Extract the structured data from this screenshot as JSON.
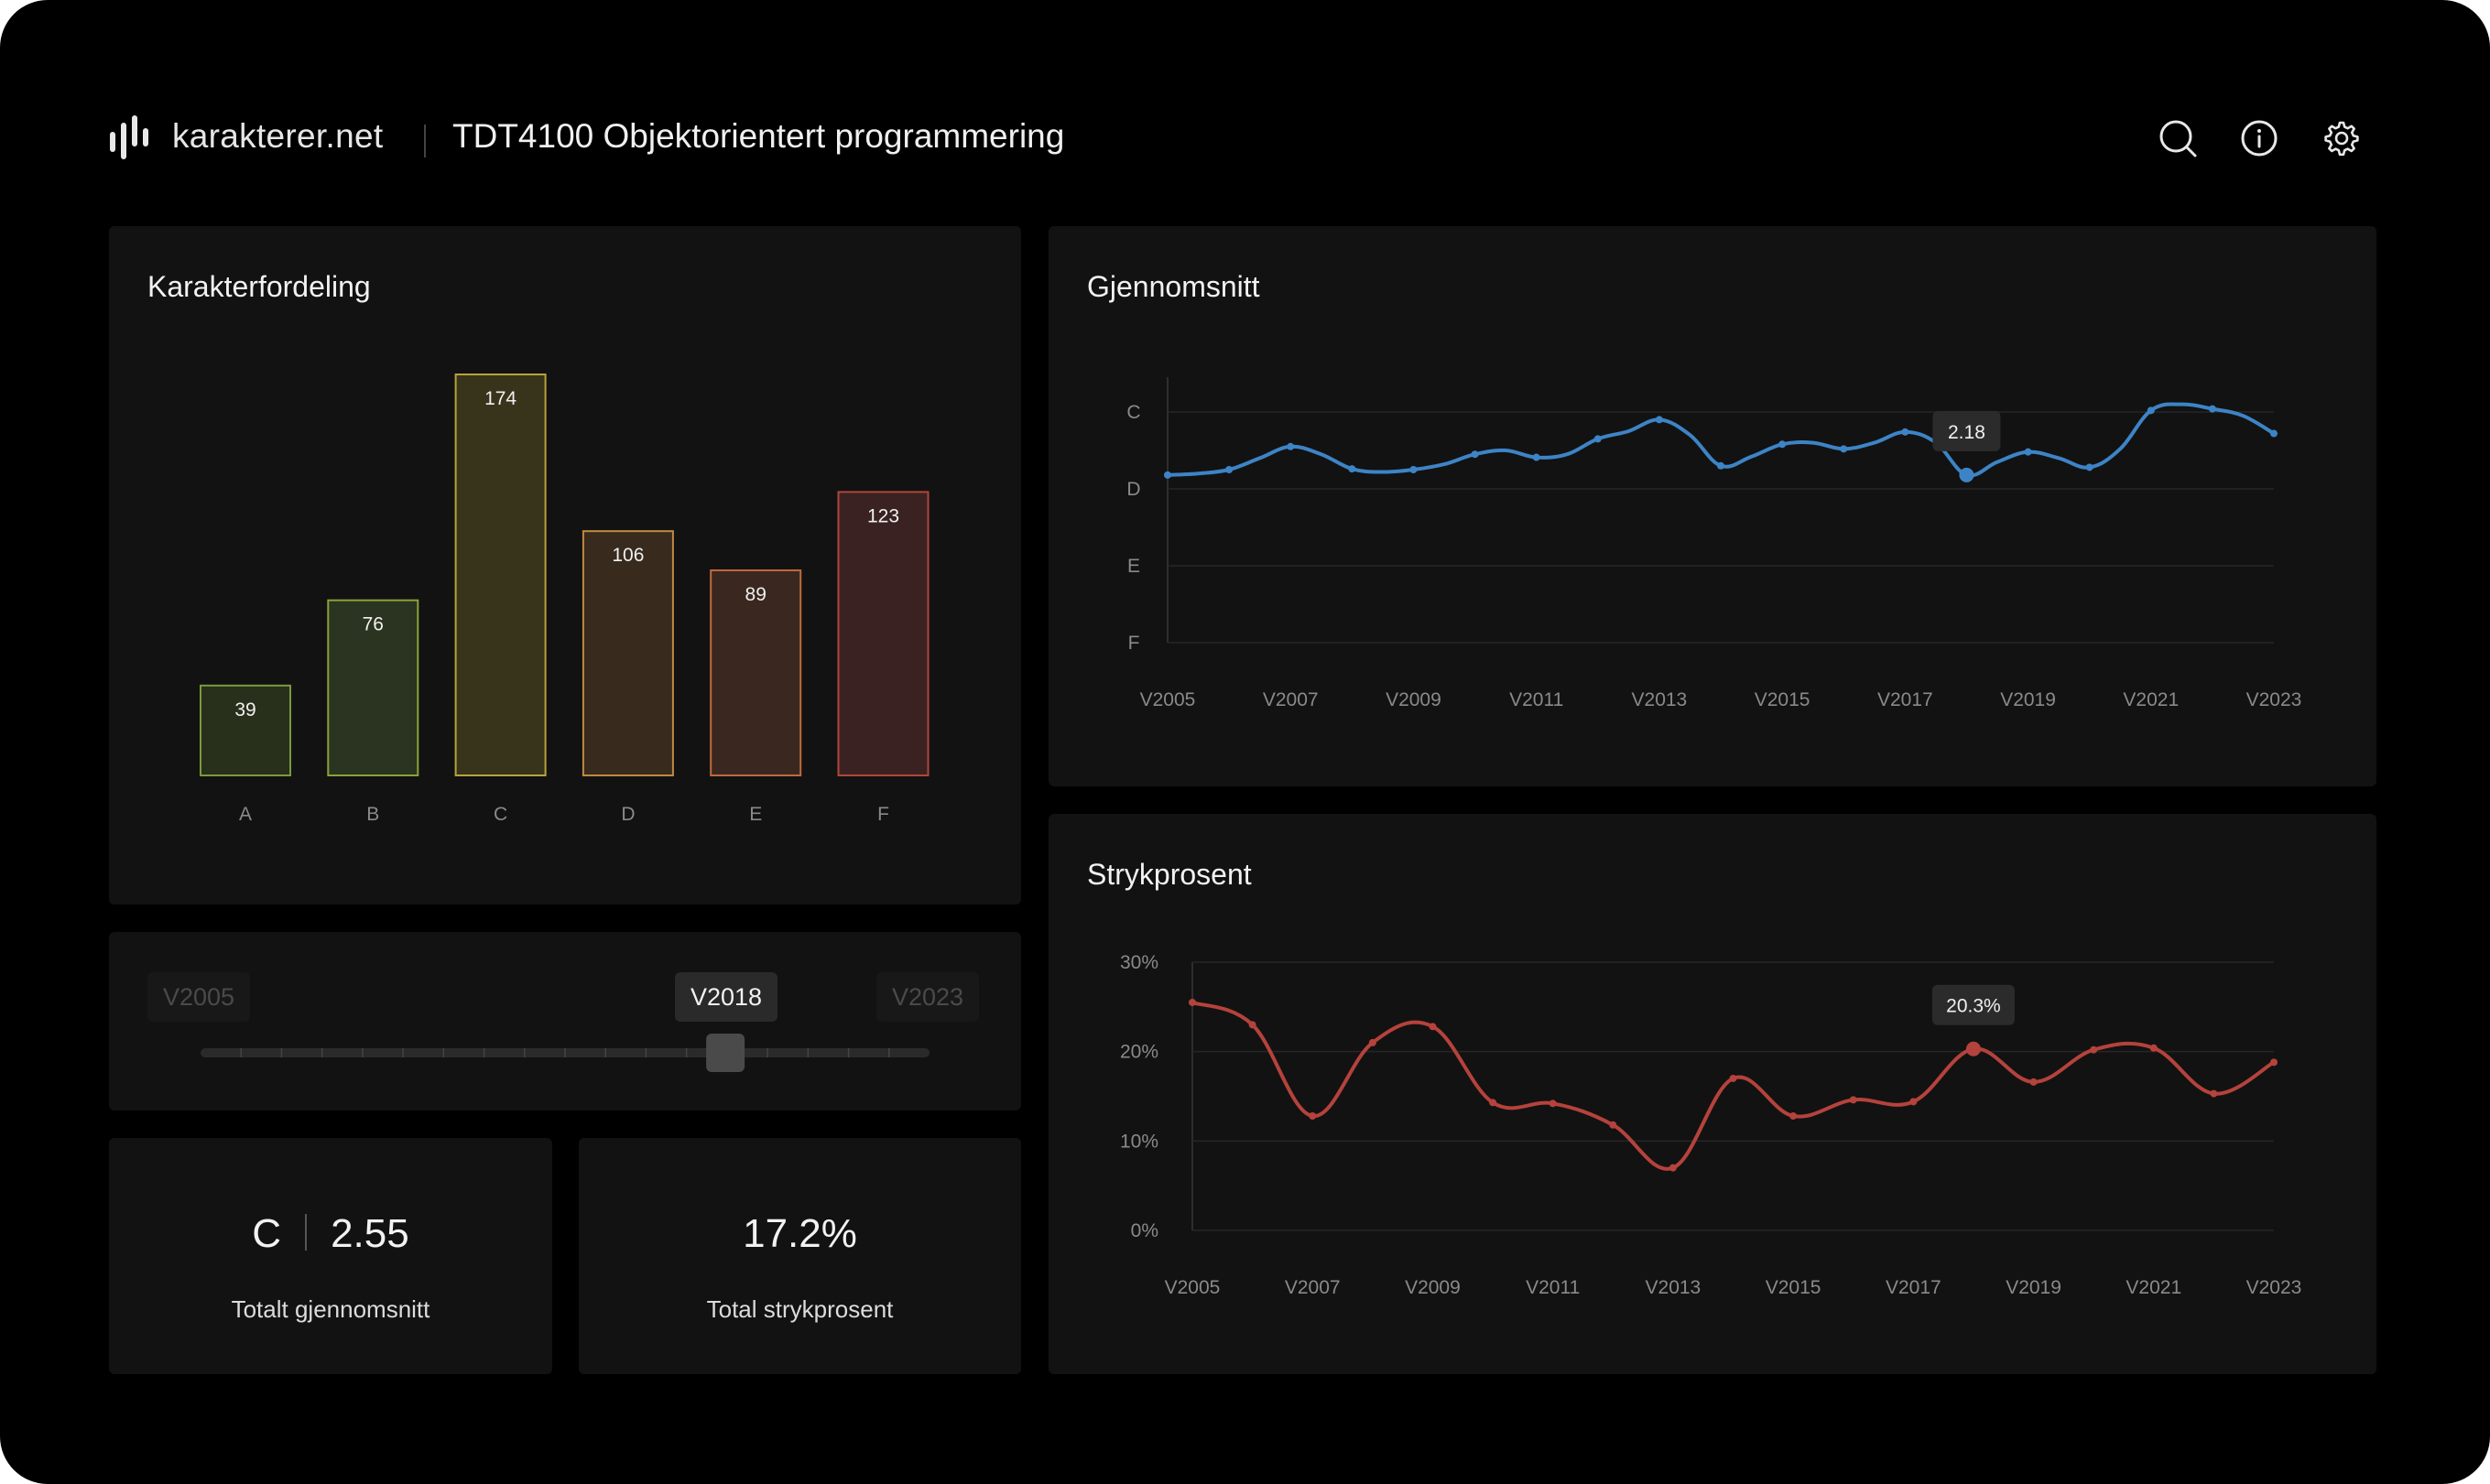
{
  "header": {
    "brand": "karakterer.net",
    "course_title": "TDT4100 Objektorientert programmering",
    "actions": [
      {
        "name": "search-icon"
      },
      {
        "name": "info-icon"
      },
      {
        "name": "settings-icon"
      }
    ]
  },
  "distribution": {
    "title": "Karakterfordeling",
    "chart_data": {
      "type": "bar",
      "categories": [
        "A",
        "B",
        "C",
        "D",
        "E",
        "F"
      ],
      "values": [
        39,
        76,
        174,
        106,
        89,
        123
      ],
      "colors": {
        "fill": [
          "#28301c",
          "#2a3420",
          "#38341c",
          "#382b1e",
          "#3a2820",
          "#3a2222"
        ],
        "stroke": [
          "#7c9a3c",
          "#8aa23a",
          "#b8a23c",
          "#c08a40",
          "#c06a3c",
          "#b0463c"
        ]
      }
    }
  },
  "average": {
    "title": "Gjennomsnitt",
    "tooltip": "2.18",
    "chart_data": {
      "type": "line",
      "y_categories": [
        "C",
        "D",
        "E",
        "F"
      ],
      "y_axis_values": [
        3,
        2,
        1,
        0
      ],
      "x_labels": [
        "V2005",
        "V2007",
        "V2009",
        "V2011",
        "V2013",
        "V2015",
        "V2017",
        "V2019",
        "V2021",
        "V2023"
      ],
      "x": [
        "V2005",
        "H2005",
        "V2006",
        "H2006",
        "V2007",
        "H2007",
        "V2008",
        "H2008",
        "V2009",
        "H2009",
        "V2010",
        "H2010",
        "V2011",
        "H2011",
        "V2012",
        "H2012",
        "V2013",
        "H2013",
        "V2014",
        "H2014",
        "V2015",
        "H2015",
        "V2016",
        "H2016",
        "V2017",
        "H2017",
        "V2018",
        "H2018",
        "V2019",
        "H2019",
        "V2020",
        "H2020",
        "V2021",
        "H2021",
        "V2022",
        "H2022",
        "V2023"
      ],
      "values": [
        2.18,
        2.2,
        2.25,
        2.4,
        2.55,
        2.45,
        2.26,
        2.22,
        2.25,
        2.32,
        2.45,
        2.5,
        2.41,
        2.45,
        2.65,
        2.75,
        2.9,
        2.7,
        2.3,
        2.42,
        2.58,
        2.6,
        2.52,
        2.6,
        2.74,
        2.6,
        2.18,
        2.35,
        2.48,
        2.4,
        2.28,
        2.52,
        3.02,
        3.1,
        3.04,
        2.95,
        2.72
      ],
      "marker_every": 2,
      "highlight_index": 26,
      "color": "#3d84c6"
    }
  },
  "failrate": {
    "title": "Strykprosent",
    "tooltip": "20.3%",
    "chart_data": {
      "type": "line",
      "y_ticks": [
        "0%",
        "10%",
        "20%",
        "30%"
      ],
      "ylim": [
        0,
        30
      ],
      "x_labels": [
        "V2005",
        "V2007",
        "V2009",
        "V2011",
        "V2013",
        "V2015",
        "V2017",
        "V2019",
        "V2021",
        "V2023"
      ],
      "x": [
        "V2005",
        "V2006",
        "V2007",
        "V2008",
        "V2009",
        "V2010",
        "V2011",
        "V2012",
        "V2013",
        "V2014",
        "V2015",
        "V2016",
        "V2017",
        "V2018",
        "V2019",
        "V2020",
        "V2021",
        "V2022",
        "V2023"
      ],
      "values": [
        25.5,
        23.0,
        12.8,
        21.0,
        22.8,
        14.3,
        14.2,
        11.8,
        7.0,
        17.0,
        12.8,
        14.6,
        14.4,
        20.3,
        16.6,
        20.2,
        20.4,
        15.3,
        18.8
      ],
      "highlight_index": 13,
      "color": "#b5423c"
    }
  },
  "slider": {
    "start": "V2005",
    "current": "V2018",
    "end": "V2023",
    "current_fraction": 0.72
  },
  "stats": {
    "average_letter": "C",
    "average_value": "2.55",
    "average_label": "Totalt gjennomsnitt",
    "failrate_value": "17.2%",
    "failrate_label": "Total strykprosent"
  }
}
